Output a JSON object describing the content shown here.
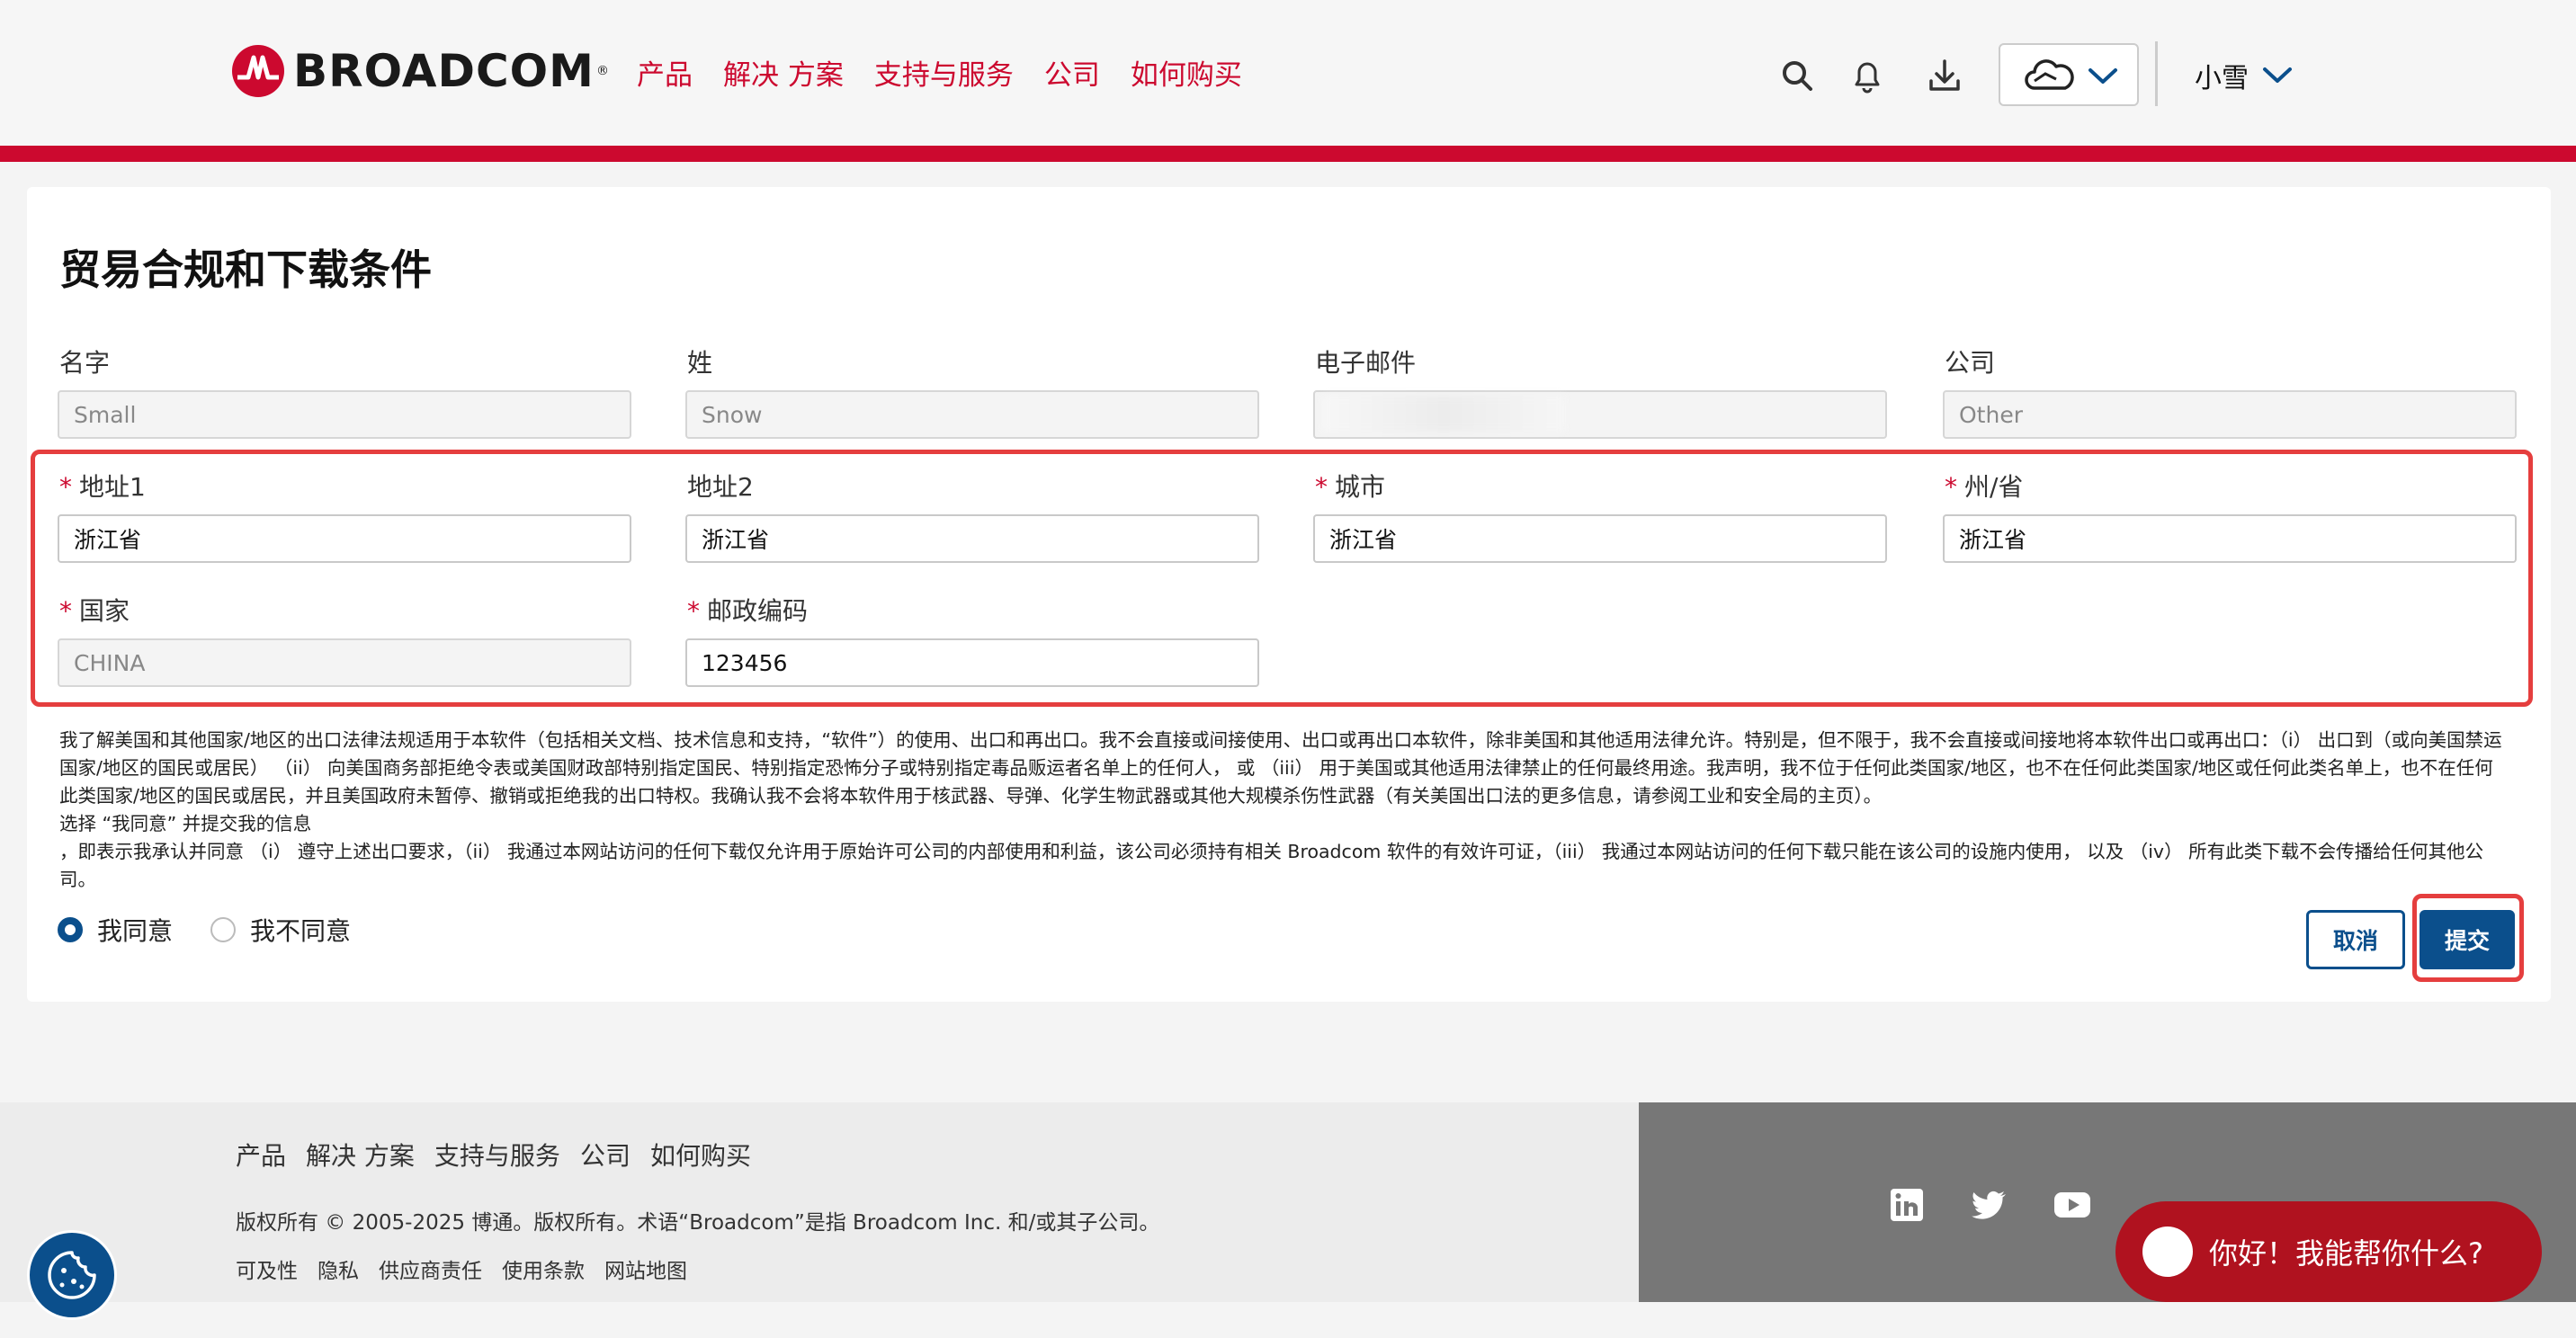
{
  "header": {
    "logo_text": "BROADCOM",
    "logo_reg": "®",
    "nav": [
      "产品",
      "解决 方案",
      "支持与服务",
      "公司",
      "如何购买"
    ],
    "user_name": "小雪",
    "brand_color": "#cc092f",
    "icons": [
      "search-icon",
      "bell-icon",
      "download-icon",
      "cloud-icon",
      "chevron-down-icon"
    ]
  },
  "page": {
    "title": "贸易合规和下载条件"
  },
  "form": {
    "first_name_label": "名字",
    "first_name_value": "Small",
    "last_name_label": "姓",
    "last_name_value": "Snow",
    "email_label": "电子邮件",
    "email_value": "",
    "company_label": "公司",
    "company_value": "Other",
    "address1_label": "地址1",
    "address1_value": "浙江省",
    "address2_label": "地址2",
    "address2_value": "浙江省",
    "city_label": "城市",
    "city_value": "浙江省",
    "state_label": "州/省",
    "state_value": "浙江省",
    "country_label": "国家",
    "country_value": "CHINA",
    "zip_label": "邮政编码",
    "zip_value": "123456",
    "required_mark": "*"
  },
  "terms": {
    "p1": "我了解美国和其他国家/地区的出口法律法规适用于本软件（包括相关文档、技术信息和支持，“软件”）的使用、出口和再出口。我不会直接或间接使用、出口或再出口本软件，除非美国和其他适用法律允许。特别是，但不限于，我不会直接或间接地将本软件出口或再出口：（i） 出口到（或向美国禁运国家/地区的国民或居民） （ii） 向美国商务部拒绝令表或美国财政部特别指定国民、特别指定恐怖分子或特别指定毒品贩运者名单上的任何人， 或 （iii） 用于美国或其他适用法律禁止的任何最终用途。我声明，我不位于任何此类国家/地区，也不在任何此类国家/地区或任何此类名单上，也不在任何此类国家/地区的国民或居民，并且美国政府未暂停、撤销或拒绝我的出口特权。我确认我不会将本软件用于核武器、导弹、化学生物武器或其他大规模杀伤性武器（有关美国出口法的更多信息，请参阅工业和安全局的主页）。",
    "p2": "选择 “我同意” 并提交我的信息",
    "p3": "，即表示我承认并同意 （i） 遵守上述出口要求，（ii） 我通过本网站访问的任何下载仅允许用于原始许可公司的内部使用和利益，该公司必须持有相关 Broadcom 软件的有效许可证，（iii） 我通过本网站访问的任何下载只能在该公司的设施内使用， 以及 （iv） 所有此类下载不会传播给任何其他公司。"
  },
  "consent": {
    "agree": "我同意",
    "disagree": "我不同意",
    "selected": "agree"
  },
  "buttons": {
    "cancel": "取消",
    "submit": "提交",
    "primary_color": "#0b4f8c"
  },
  "footer": {
    "nav": [
      "产品",
      "解决 方案",
      "支持与服务",
      "公司",
      "如何购买"
    ],
    "copyright": "版权所有 © 2005-2025 博通。版权所有。术语“Broadcom”是指 Broadcom Inc. 和/或其子公司。",
    "links": [
      "可及性",
      "隐私",
      "供应商责任",
      "使用条款",
      "网站地图"
    ],
    "social_icons": [
      "linkedin-icon",
      "twitter-icon",
      "youtube-icon"
    ],
    "chat_text": "你好！我能帮你什么?"
  }
}
